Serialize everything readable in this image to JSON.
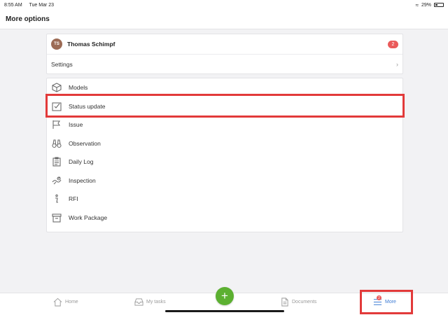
{
  "status_bar": {
    "time": "8:55 AM",
    "date": "Tue Mar 23",
    "battery": "29%"
  },
  "header": {
    "title": "More options"
  },
  "user": {
    "initials": "TS",
    "name": "Thomas Schimpf",
    "badge_count": "2"
  },
  "settings": {
    "label": "Settings"
  },
  "menu": {
    "items": [
      {
        "label": "Models",
        "icon": "cube-icon"
      },
      {
        "label": "Status update",
        "icon": "checkbox-icon"
      },
      {
        "label": "Issue",
        "icon": "flag-icon"
      },
      {
        "label": "Observation",
        "icon": "binoculars-icon"
      },
      {
        "label": "Daily Log",
        "icon": "clipboard-icon"
      },
      {
        "label": "Inspection",
        "icon": "inspection-icon"
      },
      {
        "label": "RFI",
        "icon": "info-icon"
      },
      {
        "label": "Work Package",
        "icon": "box-icon"
      }
    ]
  },
  "tabbar": {
    "home": "Home",
    "tasks": "My tasks",
    "add": "+",
    "documents": "Documents",
    "more": "More",
    "more_badge": "2"
  },
  "colors": {
    "accent": "#3d7bd4",
    "fab": "#5cb031",
    "badge": "#ea5a5a",
    "highlight": "#e23a3a"
  }
}
